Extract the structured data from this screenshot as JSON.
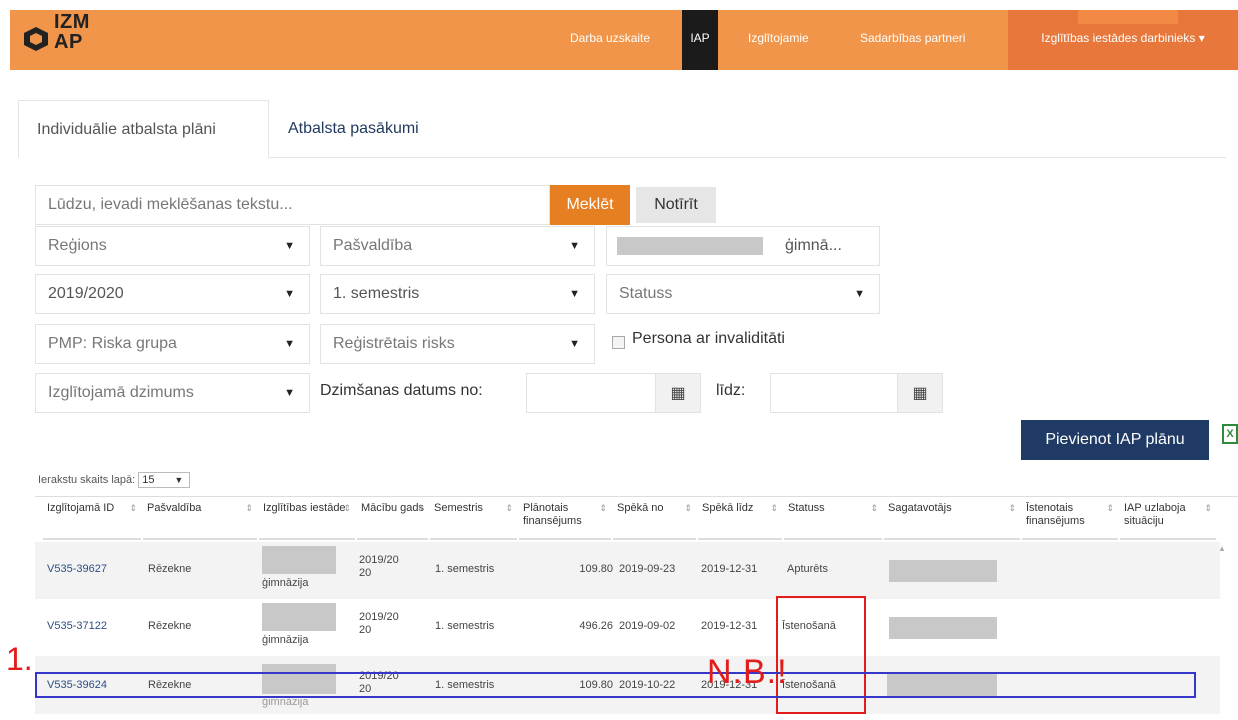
{
  "brand": {
    "logo_text_line1": "IZM",
    "logo_text_line2": "AP"
  },
  "nav": {
    "items": [
      "Darba uzskaite",
      "IAP",
      "Izglītojamie",
      "Sadarbības partneri"
    ],
    "user_menu": "Izglītības iestādes darbinieks",
    "active": "IAP"
  },
  "tabs": [
    "Individuālie atbalsta plāni",
    "Atbalsta pasākumi"
  ],
  "search": {
    "placeholder": "Lūdzu, ievadi meklēšanas tekstu...",
    "search_button": "Meklēt",
    "clear_button": "Notīrīt"
  },
  "filters": {
    "region": "Reģions",
    "municipality": "Pašvaldība",
    "institution_suffix": "ģimnā...",
    "year": "2019/2020",
    "semester": "1. semestris",
    "status": "Statuss",
    "pmp": "PMP: Riska grupa",
    "risk": "Reģistrētais risks",
    "disability_label": "Persona ar invaliditāti",
    "gender": "Izglītojamā dzimums",
    "birth_from_label": "Dzimšanas datums no:",
    "birth_to_label": "līdz:"
  },
  "actions": {
    "add_plan": "Pievienot IAP plānu"
  },
  "table": {
    "rows_per_page_label": "Ierakstu skaits lapā:",
    "rows_per_page": "15",
    "headers": [
      "Izglītojamā ID",
      "Pašvaldība",
      "Izglītības iestāde",
      "Mācību gads",
      "Semestris",
      "Plānotais finansējums",
      "Spēkā no",
      "Spēkā līdz",
      "Statuss",
      "Sagatavotājs",
      "Īstenotais finansējums",
      "IAP uzlaboja situāciju"
    ],
    "rows": [
      {
        "id": "V535-39627",
        "municipality": "Rēzekne",
        "institution": "ģimnāzija",
        "year": "2019/2020",
        "semester": "1. semestris",
        "funding": "109.80",
        "from": "2019-09-23",
        "to": "2019-12-31",
        "status": "Apturēts"
      },
      {
        "id": "V535-37122",
        "municipality": "Rēzekne",
        "institution": "ģimnāzija",
        "year": "2019/2020",
        "semester": "1. semestris",
        "funding": "496.26",
        "from": "2019-09-02",
        "to": "2019-12-31",
        "status": "Īstenošanā"
      },
      {
        "id": "V535-39624",
        "municipality": "Rēzekne",
        "institution": "ģimnāzija",
        "year": "2019/2020",
        "semester": "1. semestris",
        "funding": "109.80",
        "from": "2019-10-22",
        "to": "2019-12-31",
        "status": "Īstenošanā"
      }
    ]
  },
  "annotations": {
    "nb": "N.B.!",
    "marker": "1."
  },
  "colors": {
    "topbar": "#f0954a",
    "primary": "#1f3a64",
    "search": "#e67e22",
    "annotation_red": "#e21b1b",
    "annotation_blue": "#3636c9"
  }
}
